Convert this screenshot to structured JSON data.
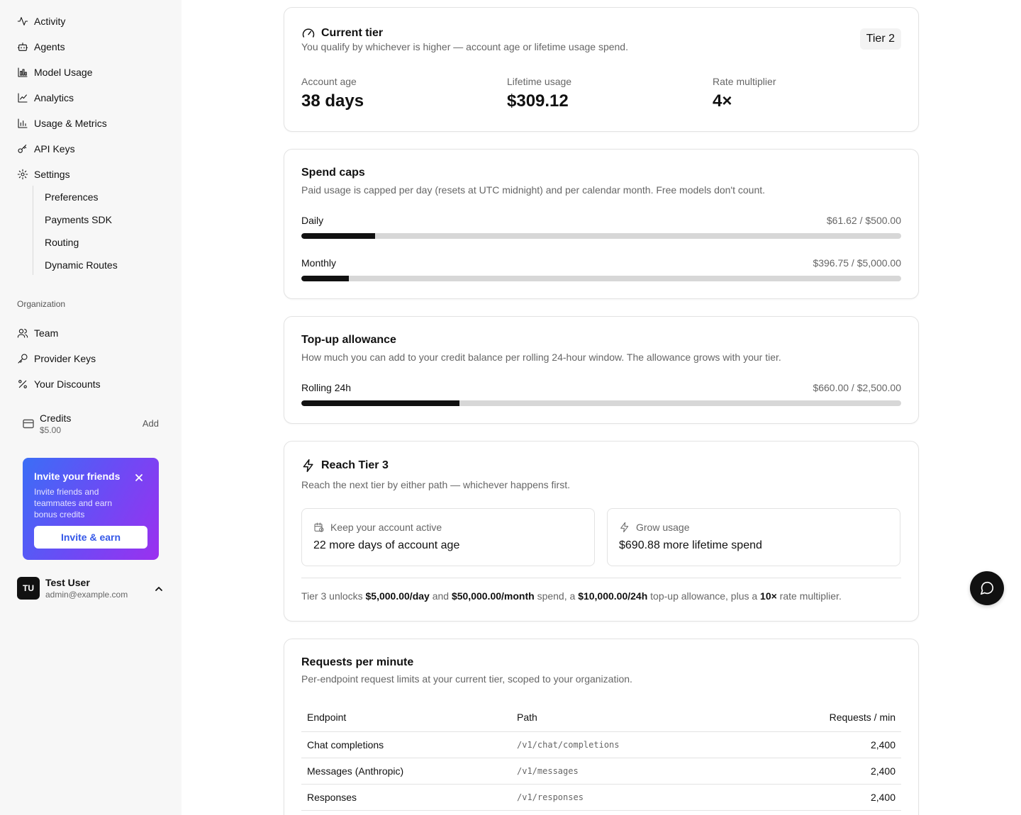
{
  "sidebar": {
    "nav": [
      {
        "label": "Activity",
        "icon": "activity-icon"
      },
      {
        "label": "Agents",
        "icon": "bot-icon"
      },
      {
        "label": "Model Usage",
        "icon": "bar-chart-icon"
      },
      {
        "label": "Analytics",
        "icon": "line-chart-icon"
      },
      {
        "label": "Usage & Metrics",
        "icon": "bar-chart-2-icon"
      },
      {
        "label": "API Keys",
        "icon": "key-icon"
      },
      {
        "label": "Settings",
        "icon": "gear-icon"
      }
    ],
    "settings_sub": [
      "Preferences",
      "Payments SDK",
      "Routing",
      "Dynamic Routes"
    ],
    "org_label": "Organization",
    "org_nav": [
      {
        "label": "Team",
        "icon": "users-icon"
      },
      {
        "label": "Provider Keys",
        "icon": "key-round-icon"
      },
      {
        "label": "Your Discounts",
        "icon": "percent-icon"
      }
    ],
    "credits": {
      "label": "Credits",
      "amount": "$5.00",
      "add": "Add"
    },
    "invite": {
      "title": "Invite your friends",
      "desc": "Invite friends and teammates and earn bonus credits",
      "button": "Invite & earn"
    },
    "user": {
      "initials": "TU",
      "name": "Test User",
      "email": "admin@example.com"
    }
  },
  "current_tier": {
    "title": "Current tier",
    "desc": "You qualify by whichever is higher — account age or lifetime usage spend.",
    "badge": "Tier 2",
    "stats": [
      {
        "label": "Account age",
        "value": "38 days"
      },
      {
        "label": "Lifetime usage",
        "value": "$309.12"
      },
      {
        "label": "Rate multiplier",
        "value": "4×"
      }
    ]
  },
  "spend_caps": {
    "title": "Spend caps",
    "desc": "Paid usage is capped per day (resets at UTC midnight) and per calendar month. Free models don't count.",
    "rows": [
      {
        "label": "Daily",
        "nums": "$61.62 / $500.00",
        "fraction": 0.1232
      },
      {
        "label": "Monthly",
        "nums": "$396.75 / $5,000.00",
        "fraction": 0.0794
      }
    ]
  },
  "topup": {
    "title": "Top-up allowance",
    "desc": "How much you can add to your credit balance per rolling 24-hour window. The allowance grows with your tier.",
    "row": {
      "label": "Rolling 24h",
      "nums": "$660.00 / $2,500.00",
      "fraction": 0.264
    }
  },
  "reach": {
    "title": "Reach Tier 3",
    "desc": "Reach the next tier by either path — whichever happens first.",
    "paths": [
      {
        "head": "Keep your account active",
        "body": "22 more days of account age",
        "icon": "calendar-clock-icon"
      },
      {
        "head": "Grow usage",
        "body": "$690.88 more lifetime spend",
        "icon": "zap-icon"
      }
    ],
    "unlock": {
      "t1": "Tier 3 unlocks ",
      "b1": "$5,000.00/day",
      "t2": " and ",
      "b2": "$50,000.00/month",
      "t3": " spend, a ",
      "b3": "$10,000.00/24h",
      "t4": " top-up allowance, plus a ",
      "b4": "10×",
      "t5": " rate multiplier."
    }
  },
  "rpm": {
    "title": "Requests per minute",
    "desc": "Per-endpoint request limits at your current tier, scoped to your organization.",
    "headers": [
      "Endpoint",
      "Path",
      "Requests / min"
    ],
    "rows": [
      {
        "endpoint": "Chat completions",
        "path": "/v1/chat/completions",
        "rpm": "2,400"
      },
      {
        "endpoint": "Messages (Anthropic)",
        "path": "/v1/messages",
        "rpm": "2,400"
      },
      {
        "endpoint": "Responses",
        "path": "/v1/responses",
        "rpm": "2,400"
      }
    ]
  }
}
